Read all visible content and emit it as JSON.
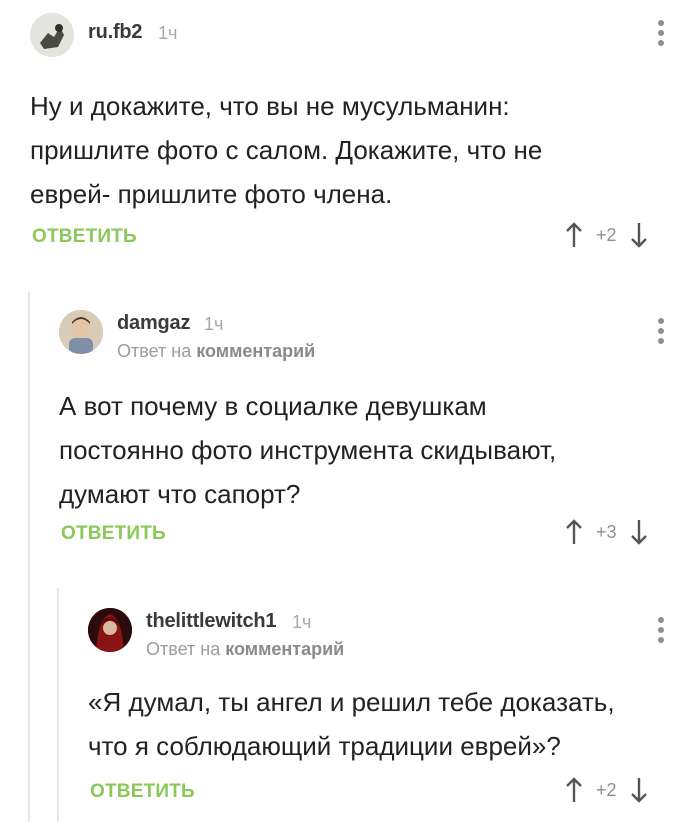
{
  "comments": [
    {
      "author": "ru.fb2",
      "time": "1ч",
      "reply_to_prefix": "",
      "reply_to_link": "",
      "lines": [
        "Ну и докажите, что вы не мусульманин:",
        "пришлите фото с салом. Докажите, что не",
        "еврей- пришлите фото члена."
      ],
      "reply_label": "ОТВЕТИТЬ",
      "score": "+2"
    },
    {
      "author": "damgaz",
      "time": "1ч",
      "reply_to_prefix": "Ответ на",
      "reply_to_link": "комментарий",
      "lines": [
        "А вот почему в социалке девушкам",
        "постоянно фото инструмента скидывают,",
        "думают что сапорт?"
      ],
      "reply_label": "ОТВЕТИТЬ",
      "score": "+3"
    },
    {
      "author": "thelittlewitch1",
      "time": "1ч",
      "reply_to_prefix": "Ответ на",
      "reply_to_link": "комментарий",
      "lines": [
        "«Я думал, ты ангел и решил тебе доказать,",
        "что я соблюдающий традиции еврей»?"
      ],
      "reply_label": "ОТВЕТИТЬ",
      "score": "+2"
    }
  ],
  "colors": {
    "accent": "#8ac858",
    "muted": "#a8a8a8",
    "text": "#222222"
  },
  "icons": [
    "avatar",
    "more-vertical-icon",
    "arrow-up-icon",
    "arrow-down-icon"
  ]
}
